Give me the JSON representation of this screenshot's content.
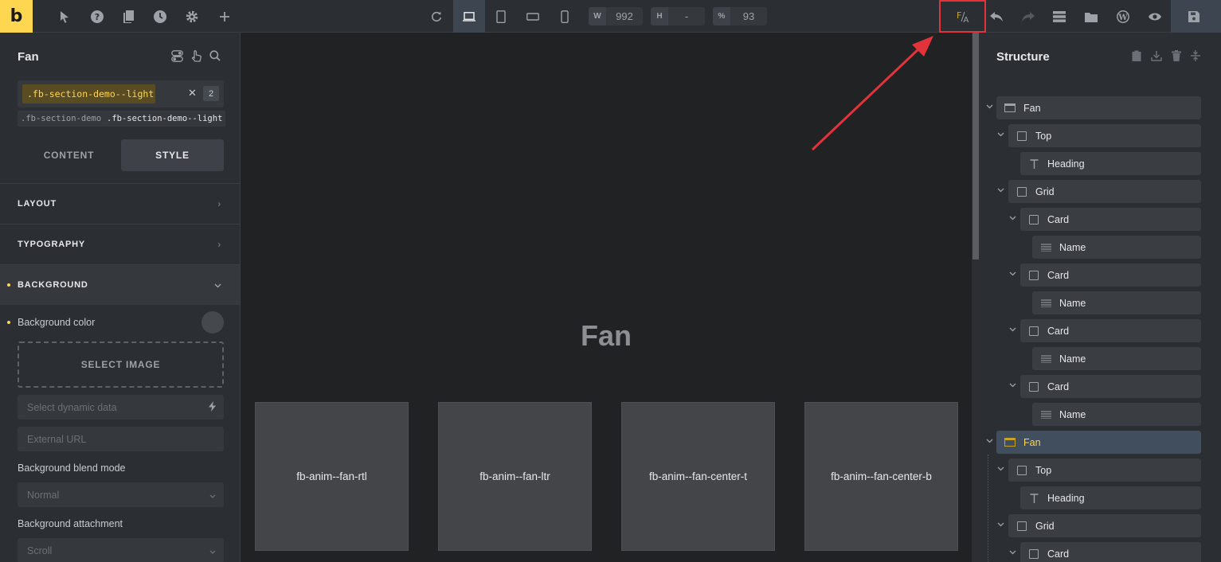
{
  "topbar": {
    "logo": "b",
    "icons": [
      "cursor-icon",
      "help-icon",
      "pages-icon",
      "history-icon",
      "settings-icon",
      "add-icon"
    ],
    "devices": [
      "refresh-icon",
      "desktop-icon",
      "tablet-portrait-icon",
      "tablet-landscape-icon",
      "mobile-icon"
    ],
    "width_label": "W",
    "width_value": "992",
    "height_label": "H",
    "height_value": "-",
    "zoom_label": "%",
    "zoom_value": "93",
    "fa_button": "F/A"
  },
  "left_panel": {
    "title": "Fan",
    "active_class": ".fb-section-demo--light",
    "class_count": "2",
    "class_tags": [
      ".fb-section-demo",
      ".fb-section-demo--light"
    ],
    "tabs": [
      "CONTENT",
      "STYLE"
    ],
    "sections": [
      "LAYOUT",
      "TYPOGRAPHY",
      "BACKGROUND"
    ],
    "bg_color_label": "Background color",
    "select_image": "SELECT IMAGE",
    "dynamic_data_placeholder": "Select dynamic data",
    "external_url_placeholder": "External URL",
    "blend_mode_label": "Background blend mode",
    "blend_mode_value": "Normal",
    "attachment_label": "Background attachment",
    "attachment_value": "Scroll"
  },
  "canvas": {
    "title": "Fan",
    "cards": [
      "fb-anim--fan-rtl",
      "fb-anim--fan-ltr",
      "fb-anim--fan-center-t",
      "fb-anim--fan-center-b"
    ]
  },
  "structure": {
    "title": "Structure",
    "nodes": [
      {
        "label": "Fan"
      },
      {
        "label": "Top"
      },
      {
        "label": "Heading"
      },
      {
        "label": "Grid"
      },
      {
        "label": "Card"
      },
      {
        "label": "Name"
      },
      {
        "label": "Card"
      },
      {
        "label": "Name"
      },
      {
        "label": "Card"
      },
      {
        "label": "Name"
      },
      {
        "label": "Card"
      },
      {
        "label": "Name"
      },
      {
        "label": "Fan"
      },
      {
        "label": "Top"
      },
      {
        "label": "Heading"
      },
      {
        "label": "Grid"
      },
      {
        "label": "Card"
      }
    ]
  },
  "colors": {
    "accent": "#ffd64f",
    "highlight_box": "#e3333a"
  }
}
